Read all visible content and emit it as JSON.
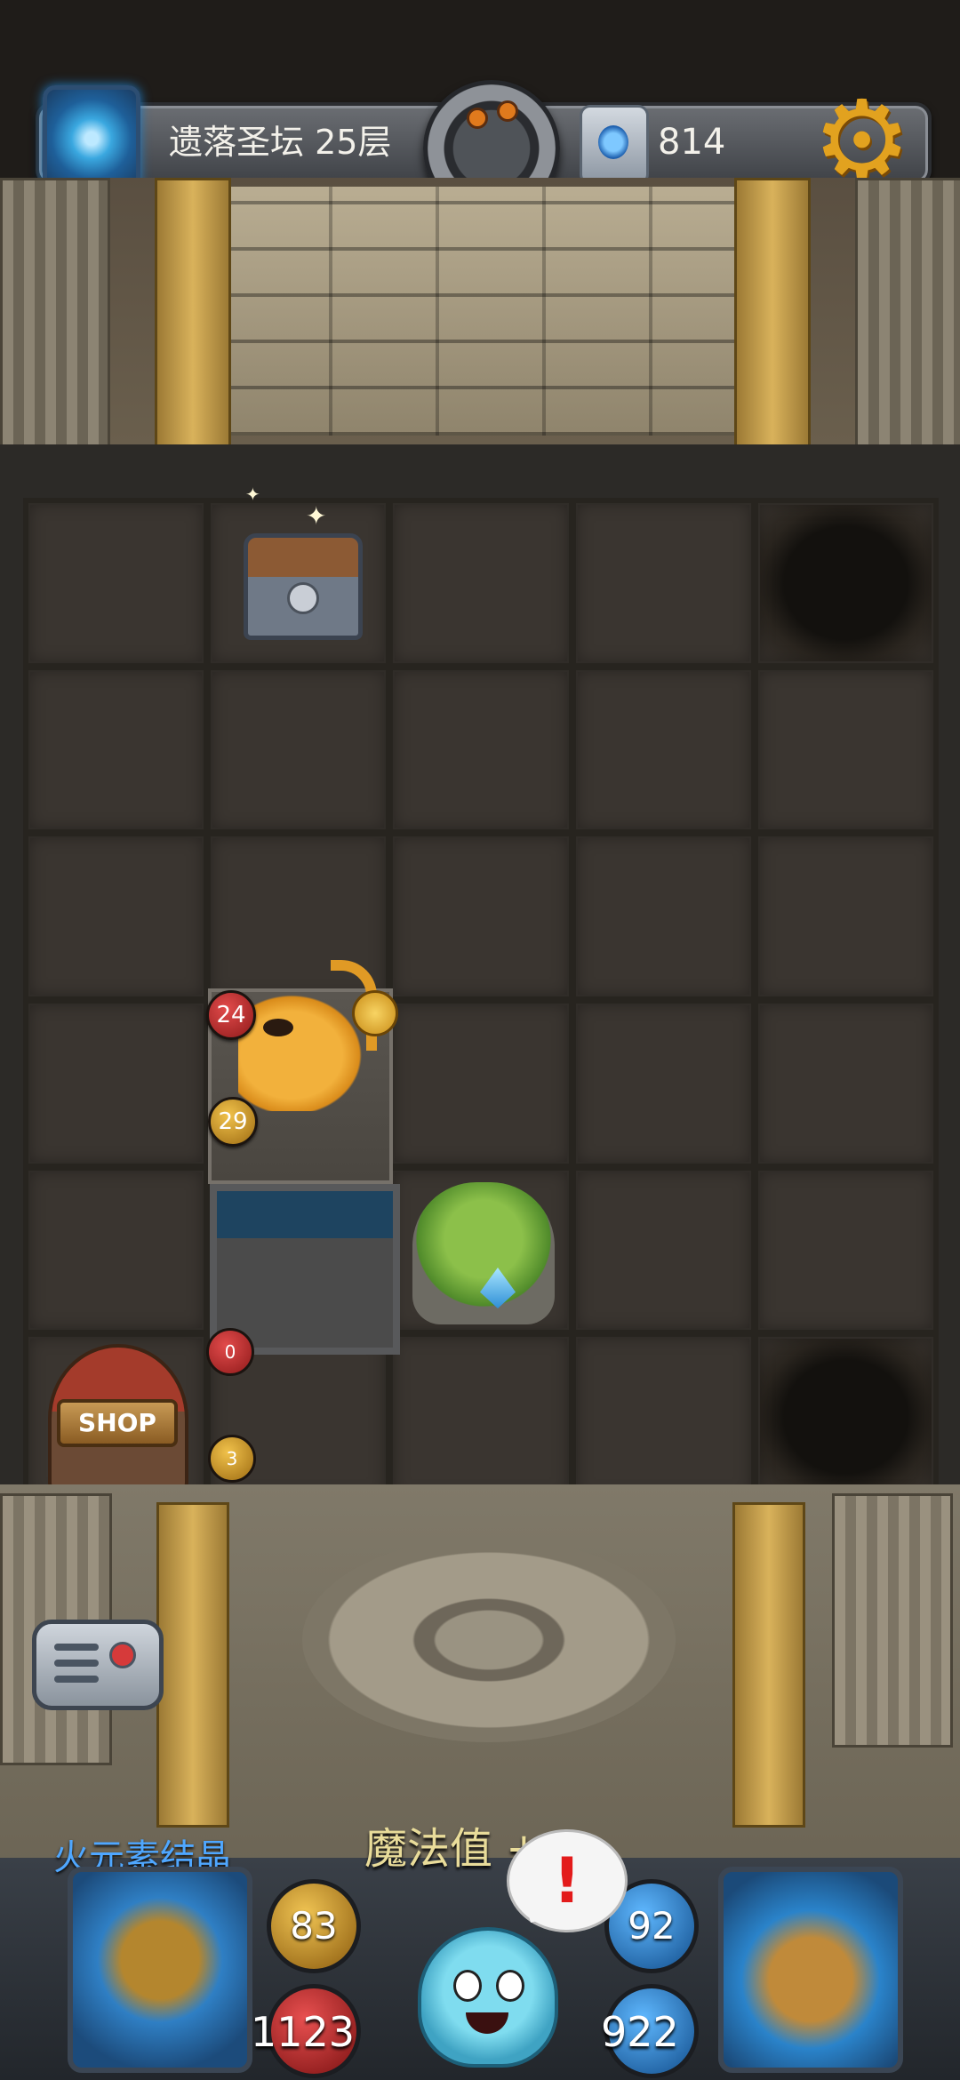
{
  "header": {
    "floor_label": "遗落圣坛 25层",
    "gem_count": "814",
    "icons": [
      "portal-icon",
      "bomb-medallion-icon",
      "gem-icon",
      "settings-gear-icon"
    ]
  },
  "board": {
    "columns": 5,
    "rows": 6,
    "monster": {
      "name": "cat-pirate-monster",
      "health": "24",
      "attack": "29"
    },
    "potion_red_value": "0",
    "potion_gold_value": "3",
    "shop_label": "SHOP"
  },
  "hud": {
    "element_label": "火元素结晶",
    "mana_message": "魔法值 +1",
    "attack": "83",
    "health": "1123",
    "mana": "92",
    "mana_pool": "922",
    "speech_mark": "!"
  },
  "colors": {
    "accent_gold": "#e2a21f",
    "element_blue": "#4fa7ff",
    "alert_red": "#e31b1b"
  }
}
